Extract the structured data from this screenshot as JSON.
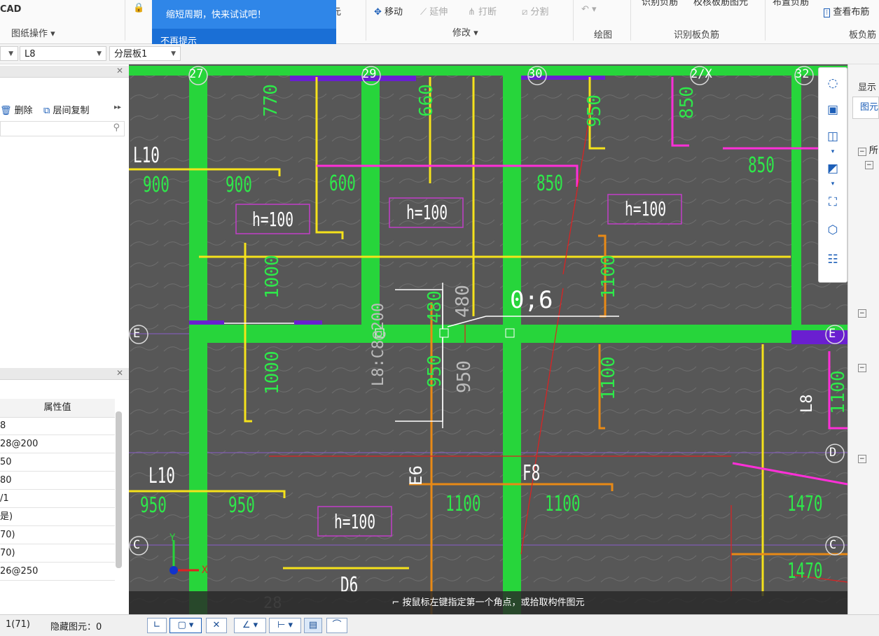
{
  "ribbon": {
    "app_label": "CAD",
    "group_drawing_ops": "图纸操作",
    "move_label": "移动",
    "extend_label": "延伸",
    "break_label": "打断",
    "split_label": "分割",
    "group_modify": "修改",
    "group_draw": "绘图",
    "group_identify_slab_neg": "识别板负筋",
    "identify_neg_label": "识别负筋",
    "check_slab_label": "校核板筋图元",
    "place_neg_label": "布置负筋",
    "view_layout_label": "查看布筋",
    "group_slab_neg": "板负筋",
    "partial_label": "元"
  },
  "tooltip": {
    "message": "缩短周期，快来试试吧！",
    "dismiss": "不再提示"
  },
  "selectors": {
    "component": "L8",
    "layer": "分层板1"
  },
  "left_panel": {
    "delete_label": "删除",
    "copy_floor_label": "层间复制",
    "prop_header": "属性值",
    "prop_values": [
      "8",
      "28@200",
      "50",
      "80",
      "/1",
      "是)",
      "70)",
      "70)",
      "26@250"
    ]
  },
  "canvas": {
    "axis_top": [
      "27",
      "29",
      "30",
      "2/X",
      "32"
    ],
    "axis_rows": [
      "E",
      "D",
      "C"
    ],
    "axis_bottom": "28",
    "dims": {
      "d770": "770",
      "d660": "660",
      "d950a": "950",
      "d850a": "850",
      "d850b": "850",
      "d850c": "850",
      "d900a": "900",
      "d900b": "900",
      "d600": "600",
      "d1000a": "1000",
      "d1100a": "1100",
      "d480a": "480",
      "d480b": "480",
      "d950b": "950",
      "d950c": "950",
      "d1000b": "1000",
      "d1100b": "1100",
      "d1100c": "1100",
      "d950d": "950",
      "d950e": "950",
      "d1100d": "1100",
      "d1100e": "1100",
      "d1470a": "1470",
      "d1470b": "1470"
    },
    "h_labels": [
      "h=100",
      "h=100",
      "h=100",
      "h=100"
    ],
    "beam_labels": {
      "l10a": "L10",
      "l10b": "L10",
      "l8c": "L8:C8@200",
      "l8r": "L8",
      "e6": "E6",
      "f8": "F8",
      "d6": "D6"
    },
    "cursor_label": "0;6",
    "axis_x": "X",
    "axis_y": "Y"
  },
  "hint": "按鼠标左键指定第一个角点，或拾取构件图元",
  "right_panel": {
    "display_label": "显示",
    "tab_label": "图元",
    "tree_label": "所"
  },
  "status": {
    "count": "1(71)",
    "hidden_label": "隐藏图元：0"
  }
}
